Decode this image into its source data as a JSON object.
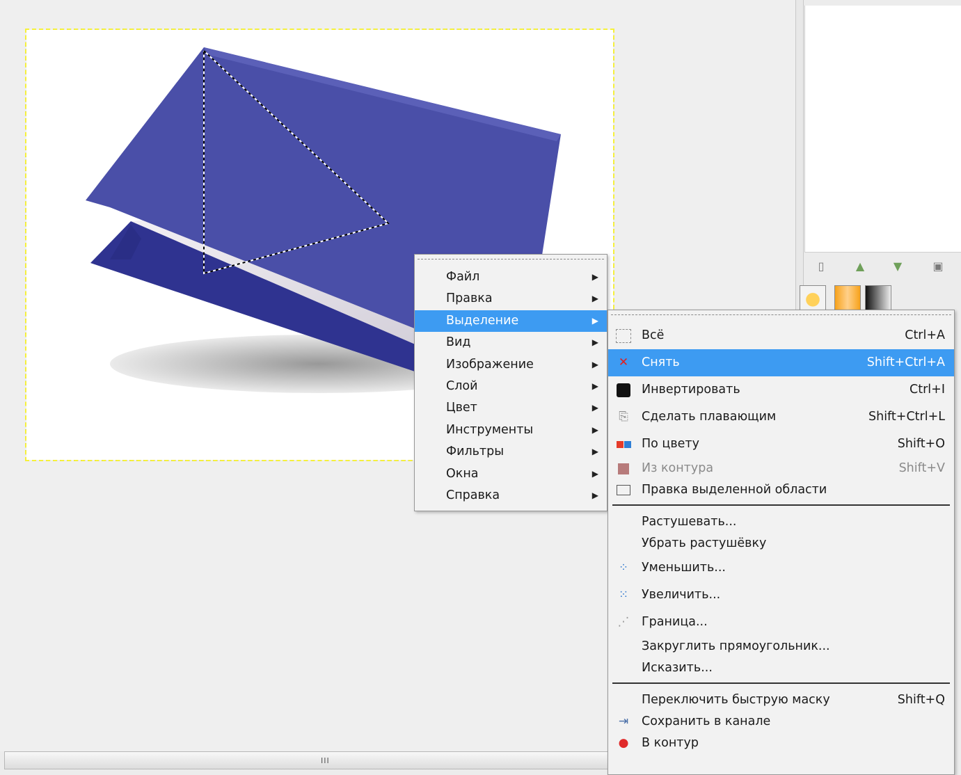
{
  "main_menu": {
    "items": [
      {
        "label": "Файл"
      },
      {
        "label": "Правка"
      },
      {
        "label": "Выделение"
      },
      {
        "label": "Вид"
      },
      {
        "label": "Изображение"
      },
      {
        "label": "Слой"
      },
      {
        "label": "Цвет"
      },
      {
        "label": "Инструменты"
      },
      {
        "label": "Фильтры"
      },
      {
        "label": "Окна"
      },
      {
        "label": "Справка"
      }
    ],
    "active_item": "Выделение"
  },
  "selection_submenu": {
    "items": [
      {
        "label": "Всё",
        "shortcut": "Ctrl+A",
        "icon": "select-all-icon"
      },
      {
        "label": "Снять",
        "shortcut": "Shift+Ctrl+A",
        "icon": "select-none-icon",
        "highlighted": true
      },
      {
        "label": "Инвертировать",
        "shortcut": "Ctrl+I",
        "icon": "invert-selection-icon"
      },
      {
        "label": "Сделать плавающим",
        "shortcut": "Shift+Ctrl+L",
        "icon": "float-selection-icon"
      },
      {
        "label": "По цвету",
        "shortcut": "Shift+O",
        "icon": "select-by-color-icon"
      },
      {
        "label": "Из контура",
        "shortcut": "Shift+V",
        "icon": "from-path-icon",
        "disabled": true
      },
      {
        "label": "Правка выделенной области",
        "shortcut": "",
        "icon": "selection-editor-icon"
      },
      {
        "label": "Растушевать...",
        "shortcut": "",
        "icon": ""
      },
      {
        "label": "Убрать растушёвку",
        "shortcut": "",
        "icon": ""
      },
      {
        "label": "Уменьшить...",
        "shortcut": "",
        "icon": "shrink-icon"
      },
      {
        "label": "Увеличить...",
        "shortcut": "",
        "icon": "grow-icon"
      },
      {
        "label": "Граница...",
        "shortcut": "",
        "icon": "border-icon"
      },
      {
        "label": "Закруглить прямоугольник...",
        "shortcut": "",
        "icon": ""
      },
      {
        "label": "Исказить...",
        "shortcut": "",
        "icon": ""
      },
      {
        "label": "Переключить быструю маску",
        "shortcut": "Shift+Q",
        "icon": ""
      },
      {
        "label": "Сохранить в канале",
        "shortcut": "",
        "icon": "save-to-channel-icon"
      },
      {
        "label": "В контур",
        "shortcut": "",
        "icon": "to-path-icon"
      }
    ]
  },
  "scrollbar": {
    "grip": "III"
  },
  "colors": {
    "highlight": "#3d9bf2",
    "book_cover": "#4a4fa8",
    "selection_dash": "#f6f13a"
  }
}
